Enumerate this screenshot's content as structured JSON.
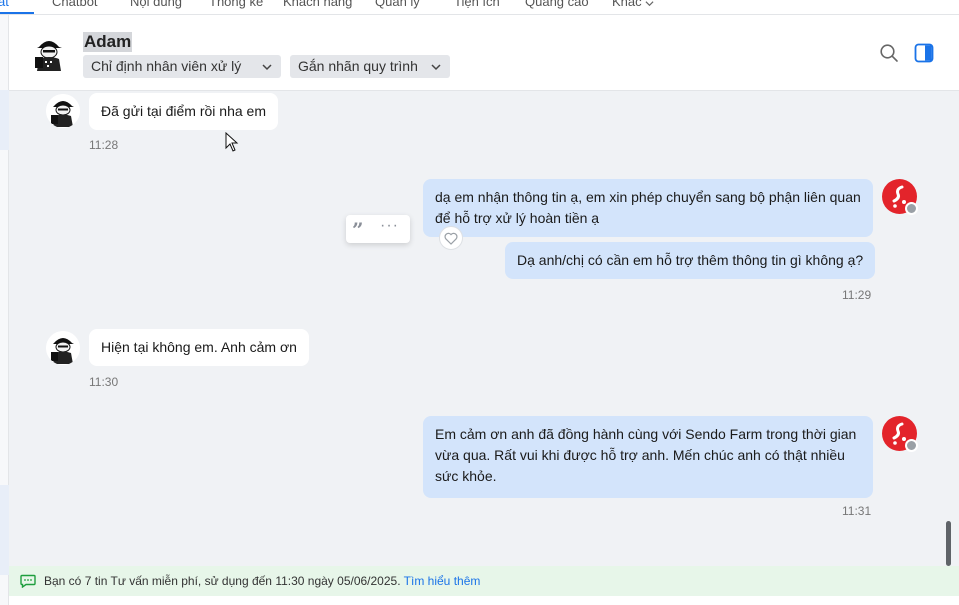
{
  "topnav": {
    "items": [
      "at",
      "Chatbot",
      "Nội dung",
      "Thống kê",
      "Khách hàng",
      "Quản lý",
      "Tiện ích",
      "Quảng cáo",
      "Khác"
    ]
  },
  "header": {
    "contact_name": "Adam",
    "assign_dropdown": "Chỉ định nhân viên xử lý",
    "tag_dropdown": "Gắn nhãn quy trình"
  },
  "messages": [
    {
      "side": "in",
      "text": "Đã gửi tại điểm rồi nha em",
      "time": "11:28"
    },
    {
      "side": "out",
      "text": "dạ em nhận thông tin ạ, em xin phép chuyển sang bộ phận liên quan để hỗ trợ xử lý hoàn tiền ạ",
      "time": ""
    },
    {
      "side": "out",
      "text": "Dạ anh/chị có cần em hỗ trợ thêm thông tin gì không ạ?",
      "time": "11:29"
    },
    {
      "side": "in",
      "text": "Hiện tại không em. Anh cảm ơn",
      "time": "11:30"
    },
    {
      "side": "out",
      "text": "Em cảm ơn anh đã đồng hành cùng với Sendo Farm trong thời gian vừa qua. Rất vui khi được hỗ trợ anh. Mến chúc anh có thật nhiều sức khỏe.",
      "time": "11:31"
    }
  ],
  "footer": {
    "notice": "Bạn có 7 tin Tư vấn miễn phí, sử dụng đến 11:30 ngày 05/06/2025.",
    "link": "Tìm hiểu thêm"
  },
  "icons": {
    "search": "search-icon",
    "panel": "side-panel-icon",
    "quote": "quote-icon",
    "more": "more-icon",
    "heart": "heart-icon",
    "chat": "chat-icon"
  },
  "colors": {
    "accent": "#1a73e8",
    "outgoing_bubble": "#d3e4fb",
    "incoming_bubble": "#ffffff",
    "shop_avatar": "#e3242b",
    "footer_bg": "#e7f6e9"
  }
}
